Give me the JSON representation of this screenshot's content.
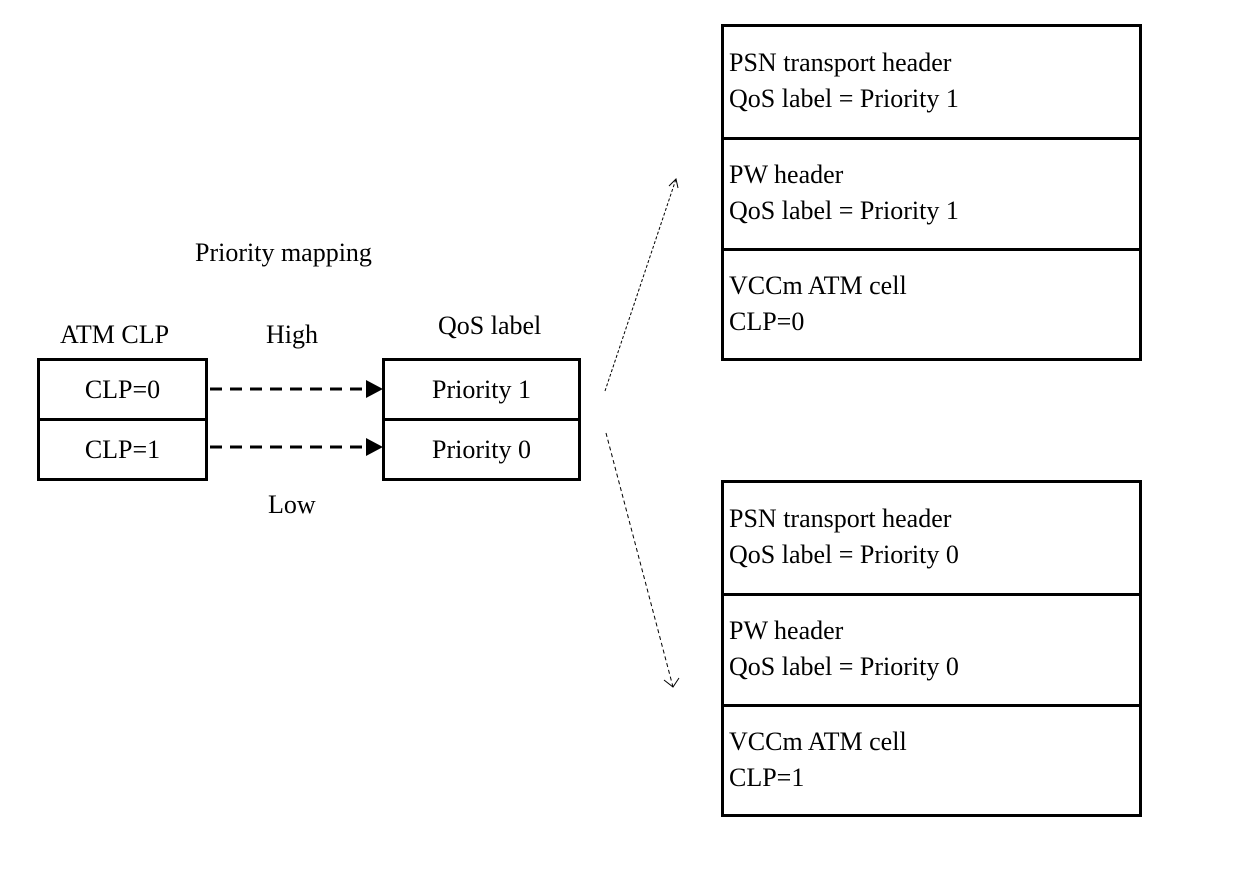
{
  "left": {
    "title": "Priority mapping",
    "atm_header": "ATM CLP",
    "qos_header": "QoS label",
    "high_label": "High",
    "low_label": "Low",
    "atm_cells": [
      "CLP=0",
      "CLP=1"
    ],
    "qos_cells": [
      "Priority 1",
      "Priority 0"
    ]
  },
  "stacks": [
    {
      "segments": [
        {
          "line1": "PSN transport header",
          "line2": "QoS label = Priority 1"
        },
        {
          "line1": "PW header",
          "line2": "QoS label = Priority 1"
        },
        {
          "line1": "VCCm ATM cell",
          "line2": "CLP=0"
        }
      ]
    },
    {
      "segments": [
        {
          "line1": "PSN transport header",
          "line2": "QoS label = Priority 0"
        },
        {
          "line1": "PW header",
          "line2": "QoS label = Priority 0"
        },
        {
          "line1": "VCCm ATM cell",
          "line2": "CLP=1"
        }
      ]
    }
  ]
}
